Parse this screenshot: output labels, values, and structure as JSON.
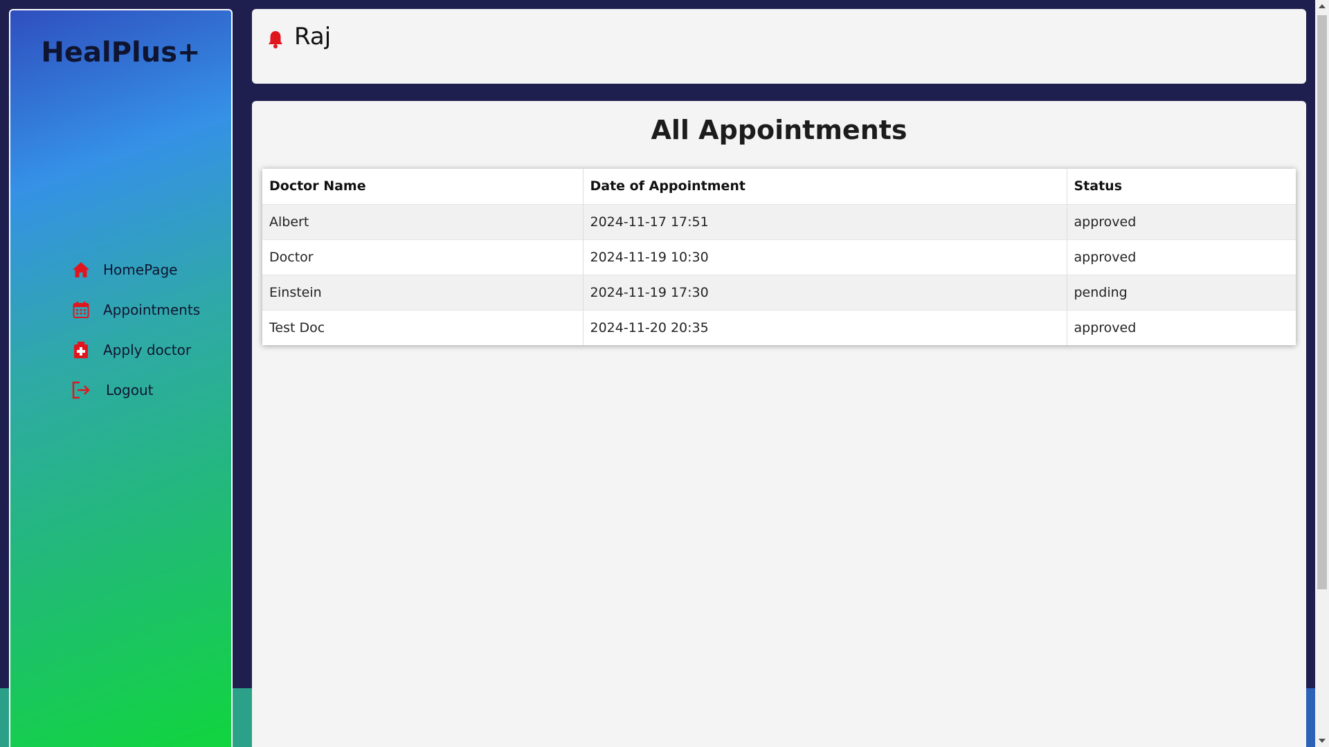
{
  "brand": "HealPlus+",
  "colors": {
    "icon_red": "#e0161f",
    "page_background": "#1f1f4f",
    "sidebar_gradient_start": "#2f4fbf",
    "sidebar_gradient_end": "#10d63c"
  },
  "sidebar": {
    "items": [
      {
        "label": "HomePage",
        "icon": "home-icon"
      },
      {
        "label": "Appointments",
        "icon": "calendar-icon"
      },
      {
        "label": "Apply doctor",
        "icon": "medical-kit-icon"
      },
      {
        "label": "Logout",
        "icon": "logout-icon"
      }
    ]
  },
  "header": {
    "icon": "bell-icon",
    "username": "Raj"
  },
  "main": {
    "title": "All Appointments",
    "table": {
      "columns": [
        "Doctor Name",
        "Date of Appointment",
        "Status"
      ],
      "rows": [
        [
          "Albert",
          "2024-11-17 17:51",
          "approved"
        ],
        [
          "Doctor",
          "2024-11-19 10:30",
          "approved"
        ],
        [
          "Einstein",
          "2024-11-19 17:30",
          "pending"
        ],
        [
          "Test Doc",
          "2024-11-20 20:35",
          "approved"
        ]
      ]
    }
  }
}
